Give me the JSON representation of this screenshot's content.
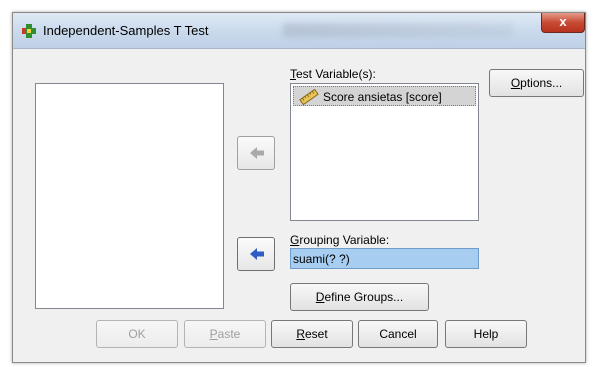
{
  "dialog": {
    "title": "Independent-Samples T Test",
    "close_label": "x"
  },
  "test_variables": {
    "label_mnemonic": "T",
    "label_rest": "est Variable(s):",
    "items": [
      {
        "label": "Score ansietas [score]",
        "icon": "scale-variable-icon"
      }
    ]
  },
  "grouping_variable": {
    "label_mnemonic": "G",
    "label_rest": "rouping Variable:",
    "value": "suami(? ?)"
  },
  "buttons": {
    "options_mnemonic": "O",
    "options_rest": "ptions...",
    "define_groups_mnemonic": "D",
    "define_groups_rest": "efine Groups...",
    "ok": "OK",
    "paste_mnemonic": "P",
    "paste_rest": "aste",
    "reset_mnemonic": "R",
    "reset_rest": "eset",
    "cancel": "Cancel",
    "help": "Help"
  },
  "colors": {
    "selection": "#a7cdf0",
    "close_button": "#c74b35",
    "dialog_bg": "#f0f0f0"
  }
}
